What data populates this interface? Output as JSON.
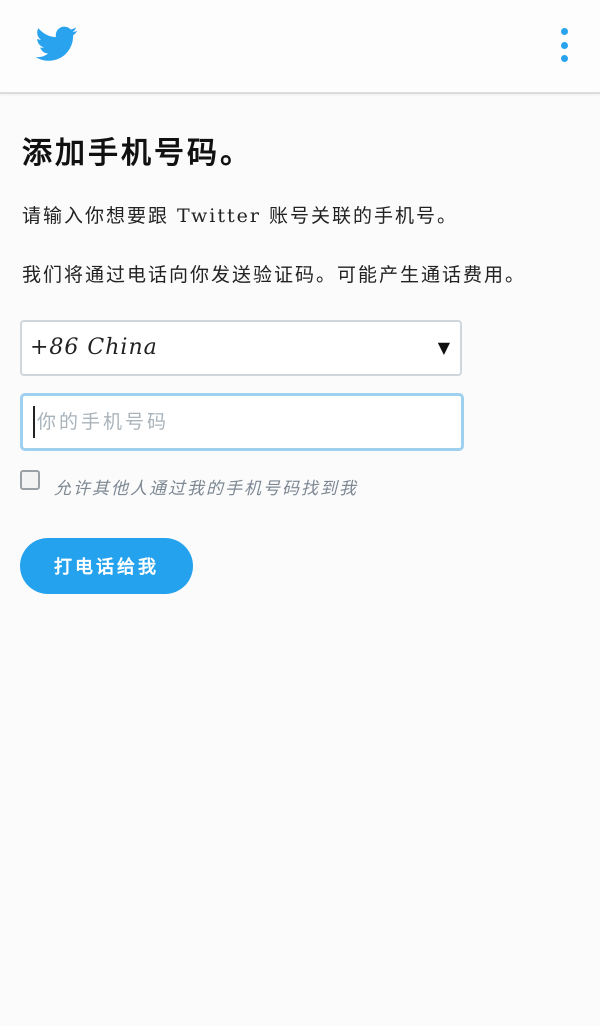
{
  "header": {
    "logo_icon": "twitter-bird-icon",
    "menu_icon": "more-vertical-icon",
    "accent_color": "#2aa3ef"
  },
  "main": {
    "title": "添加手机号码。",
    "description_1": "请输入你想要跟 Twitter 账号关联的手机号。",
    "description_2": "我们将通过电话向你发送验证码。可能产生通话费用。",
    "country_select": {
      "value": "+86 China",
      "caret_icon": "triangle-down-icon"
    },
    "phone_input": {
      "placeholder": "你的手机号码",
      "value": ""
    },
    "discoverable_checkbox": {
      "label": "允许其他人通过我的手机号码找到我",
      "checked": false
    },
    "call_button_label": "打电话给我",
    "button_color": "#25a2ed"
  }
}
